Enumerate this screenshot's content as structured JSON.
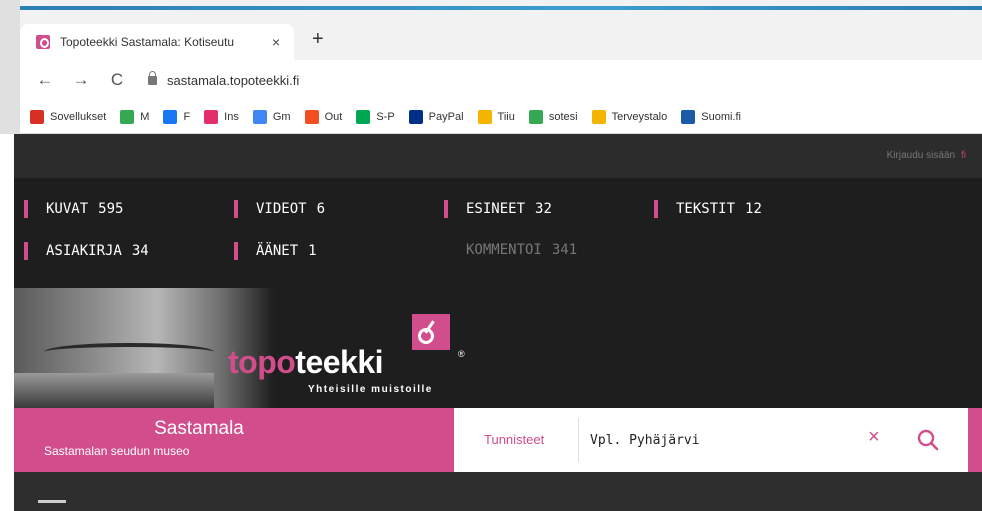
{
  "browser": {
    "tab_title": "Topoteekki Sastamala: Kotiseutu",
    "tab_close": "×",
    "new_tab": "+",
    "back": "←",
    "forward": "→",
    "reload": "C",
    "url": "sastamala.topoteekki.fi",
    "bookmarks": [
      {
        "label": "Sovellukset",
        "icon": "apps-grid-icon",
        "color": "#d93025"
      },
      {
        "label": "M",
        "icon": "map-pin-icon",
        "color": "#34a853"
      },
      {
        "label": "F",
        "icon": "facebook-icon",
        "color": "#1877f2"
      },
      {
        "label": "Ins",
        "icon": "instagram-icon",
        "color": "#e1306c"
      },
      {
        "label": "Gm",
        "icon": "google-icon",
        "color": "#4285f4"
      },
      {
        "label": "Out",
        "icon": "office-icon",
        "color": "#f25022"
      },
      {
        "label": "S-P",
        "icon": "sp-icon",
        "color": "#00a651"
      },
      {
        "label": "PayPal",
        "icon": "paypal-icon",
        "color": "#003087"
      },
      {
        "label": "Tiiu",
        "icon": "folder-icon",
        "color": "#f4b400"
      },
      {
        "label": "sotesi",
        "icon": "menu-lines-icon",
        "color": "#34a853"
      },
      {
        "label": "Terveystalo",
        "icon": "folder-icon",
        "color": "#f4b400"
      },
      {
        "label": "Suomi.fi",
        "icon": "suomifi-icon",
        "color": "#1a5aa6"
      }
    ]
  },
  "site": {
    "login_text": "Kirjaudu sisään",
    "login_flag": "fi",
    "stats": [
      {
        "label": "KUVAT",
        "value": "595"
      },
      {
        "label": "VIDEOT",
        "value": "6"
      },
      {
        "label": "ESINEET",
        "value": "32"
      },
      {
        "label": "TEKSTIT",
        "value": "12"
      },
      {
        "label": "ASIAKIRJA",
        "value": "34"
      },
      {
        "label": "ÄÄNET",
        "value": "1"
      },
      {
        "label": "KOMMENTOI",
        "value": "341"
      }
    ],
    "logo": {
      "part1": "topo",
      "part2": "teekki",
      "registered": "®",
      "tagline": "Yhteisille muistoille"
    },
    "org_name": "Sastamala",
    "org_subtitle": "Sastamalan seudun museo",
    "search": {
      "tag_label": "Tunnisteet",
      "value": "Vpl. Pyhäjärvi",
      "clear": "×"
    },
    "accent_color": "#d14d8b"
  }
}
